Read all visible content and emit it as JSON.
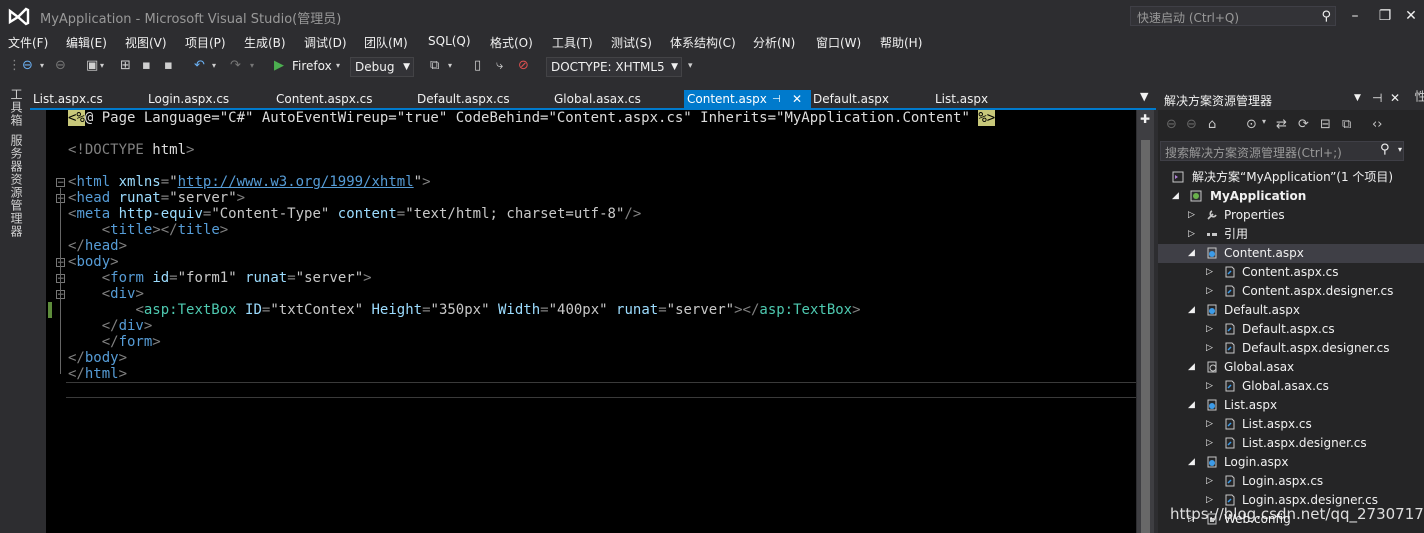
{
  "window": {
    "title": "MyApplication - Microsoft Visual Studio(管理员)",
    "quick_launch_placeholder": "快速启动 (Ctrl+Q)"
  },
  "menu": [
    "文件(F)",
    "编辑(E)",
    "视图(V)",
    "项目(P)",
    "生成(B)",
    "调试(D)",
    "团队(M)",
    "SQL(Q)",
    "格式(O)",
    "工具(T)",
    "测试(S)",
    "体系结构(C)",
    "分析(N)",
    "窗口(W)",
    "帮助(H)"
  ],
  "toolbar": {
    "browser_label": "Firefox",
    "config_label": "Debug",
    "doctype_label": "DOCTYPE:  XHTML5"
  },
  "left_strip": {
    "toolbox": "工具箱",
    "server_explorer": "服务器资源管理器"
  },
  "right_strip": {
    "label": "属性"
  },
  "tabs": [
    "List.aspx.cs",
    "Login.aspx.cs",
    "Content.aspx.cs",
    "Default.aspx.cs",
    "Global.asax.cs",
    "Content.aspx",
    "Default.aspx",
    "List.aspx"
  ],
  "active_tab_index": 5,
  "code": {
    "line1_open": "<%",
    "line1_body": "@ Page Language=\"C#\" AutoEventWireup=\"true\" CodeBehind=\"Content.aspx.cs\" Inherits=\"MyApplication.Content\" ",
    "line1_close": "%>",
    "doctype_open": "<!DOCTYPE",
    "doctype_body": " html",
    "doctype_close": ">",
    "html_xmlns_url": "http://www.w3.org/1999/xhtml",
    "meta_content": "text/html; charset=utf-8",
    "form_id": "form1",
    "textbox_id": "txtContex",
    "textbox_height": "350px",
    "textbox_width": "400px",
    "runat": "server"
  },
  "solution_explorer": {
    "title": "解决方案资源管理器",
    "search_placeholder": "搜索解决方案资源管理器(Ctrl+;)",
    "solution_label": "解决方案“MyApplication”(1 个项目)",
    "project_label": "MyApplication",
    "items": [
      {
        "label": "Properties",
        "level": 2,
        "arrow": "▷",
        "icon": "wrench-icon"
      },
      {
        "label": "引用",
        "level": 2,
        "arrow": "▷",
        "icon": "references-icon"
      },
      {
        "label": "Content.aspx",
        "level": 2,
        "arrow": "◢",
        "icon": "web-form-icon",
        "selected": true
      },
      {
        "label": "Content.aspx.cs",
        "level": 3,
        "arrow": "▷",
        "icon": "cs-file-icon"
      },
      {
        "label": "Content.aspx.designer.cs",
        "level": 3,
        "arrow": "▷",
        "icon": "cs-file-icon"
      },
      {
        "label": "Default.aspx",
        "level": 2,
        "arrow": "◢",
        "icon": "web-form-icon"
      },
      {
        "label": "Default.aspx.cs",
        "level": 3,
        "arrow": "▷",
        "icon": "cs-file-icon"
      },
      {
        "label": "Default.aspx.designer.cs",
        "level": 3,
        "arrow": "▷",
        "icon": "cs-file-icon"
      },
      {
        "label": "Global.asax",
        "level": 2,
        "arrow": "◢",
        "icon": "global-asax-icon"
      },
      {
        "label": "Global.asax.cs",
        "level": 3,
        "arrow": "▷",
        "icon": "cs-file-icon"
      },
      {
        "label": "List.aspx",
        "level": 2,
        "arrow": "◢",
        "icon": "web-form-icon"
      },
      {
        "label": "List.aspx.cs",
        "level": 3,
        "arrow": "▷",
        "icon": "cs-file-icon"
      },
      {
        "label": "List.aspx.designer.cs",
        "level": 3,
        "arrow": "▷",
        "icon": "cs-file-icon"
      },
      {
        "label": "Login.aspx",
        "level": 2,
        "arrow": "◢",
        "icon": "web-form-icon"
      },
      {
        "label": "Login.aspx.cs",
        "level": 3,
        "arrow": "▷",
        "icon": "cs-file-icon"
      },
      {
        "label": "Login.aspx.designer.cs",
        "level": 3,
        "arrow": "▷",
        "icon": "cs-file-icon"
      },
      {
        "label": "Web.config",
        "level": 2,
        "arrow": "▷",
        "icon": "config-icon"
      }
    ]
  },
  "watermark": "https://blog.csdn.net/qq_27307175",
  "colors": {
    "accent": "#007acc",
    "chrome": "#2d2d30",
    "editor_bg": "#000000",
    "tag": "#569cd6",
    "attr": "#9cdcfe",
    "asp_tag": "#4ec9b0"
  }
}
